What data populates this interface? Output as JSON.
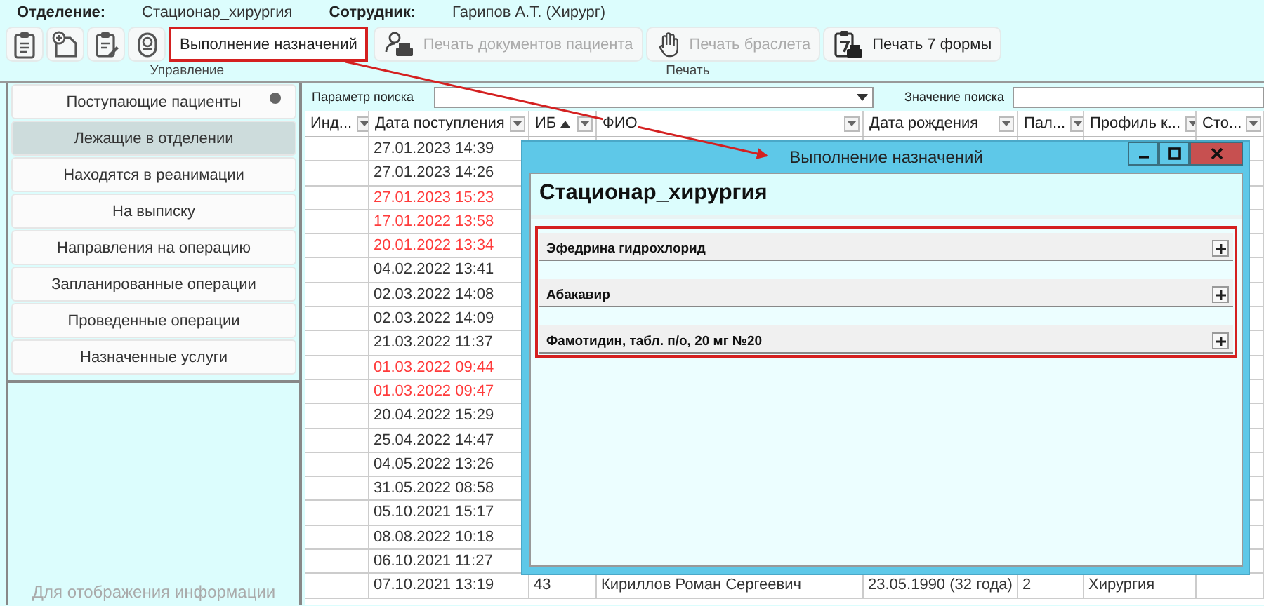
{
  "header": {
    "department_label": "Отделение:",
    "department": "Стационар_хирургия",
    "employee_label": "Сотрудник:",
    "employee": "Гарипов А.Т. (Хирург)"
  },
  "toolbar": [
    {
      "label": "Управление",
      "buttons": [
        {
          "kind": "icon"
        },
        {
          "kind": "icon"
        },
        {
          "kind": "icon"
        },
        {
          "kind": "icon"
        },
        {
          "kind": "text",
          "label": "Выполнение назначений",
          "disabled": false,
          "highlighted": true
        }
      ]
    },
    {
      "label": "Печать",
      "buttons": [
        {
          "kind": "text",
          "label": "Печать документов пациента",
          "disabled": true,
          "highlighted": false
        },
        {
          "kind": "text",
          "label": "Печать браслета",
          "disabled": true,
          "highlighted": false
        },
        {
          "kind": "text",
          "label": "Печать 7 формы",
          "disabled": false,
          "highlighted": false
        }
      ]
    }
  ],
  "callout_arrow": true,
  "sidebar": {
    "items": [
      {
        "label": "Поступающие пациенты",
        "selected": false,
        "indicator": true
      },
      {
        "label": "Лежащие в отделении",
        "selected": true,
        "indicator": false
      },
      {
        "label": "Находятся в реанимации",
        "selected": false,
        "indicator": false
      },
      {
        "label": "На выписку",
        "selected": false,
        "indicator": false
      },
      {
        "label": "Направления на операцию",
        "selected": false,
        "indicator": false
      },
      {
        "label": "Запланированные операции",
        "selected": false,
        "indicator": false
      },
      {
        "label": "Проведенные операции",
        "selected": false,
        "indicator": false
      },
      {
        "label": "Назначенные услуги",
        "selected": false,
        "indicator": false
      }
    ],
    "info_text": "Для отображения информации"
  },
  "search": {
    "param_label": "Параметр поиска",
    "value_label": "Значение поиска"
  },
  "table": {
    "columns": [
      {
        "label": "Инд...",
        "sorted": false
      },
      {
        "label": "Дата поступления",
        "sorted": false
      },
      {
        "label": "ИБ",
        "sorted": true
      },
      {
        "label": "ФИО",
        "sorted": false
      },
      {
        "label": "Дата рождения",
        "sorted": false
      },
      {
        "label": "Пал...",
        "sorted": false
      },
      {
        "label": "Профиль к...",
        "sorted": false
      },
      {
        "label": "Сто...",
        "sorted": false
      }
    ],
    "rows": [
      {
        "cells": [
          "",
          "27.01.2023 14:39"
        ],
        "color": "#333333"
      },
      {
        "cells": [
          "",
          "27.01.2023 14:26"
        ],
        "color": "#333333"
      },
      {
        "cells": [
          "",
          "27.01.2023 15:23"
        ],
        "color": "#ff3b3b"
      },
      {
        "cells": [
          "",
          "17.01.2022 13:58"
        ],
        "color": "#ff3b3b"
      },
      {
        "cells": [
          "",
          "20.01.2022 13:34"
        ],
        "color": "#ff3b3b"
      },
      {
        "cells": [
          "",
          "04.02.2022 13:41"
        ],
        "color": "#333333"
      },
      {
        "cells": [
          "",
          "02.03.2022 14:08"
        ],
        "color": "#333333"
      },
      {
        "cells": [
          "",
          "02.03.2022 14:09"
        ],
        "color": "#333333"
      },
      {
        "cells": [
          "",
          "21.03.2022 11:37"
        ],
        "color": "#333333"
      },
      {
        "cells": [
          "",
          "01.03.2022 09:44"
        ],
        "color": "#ff3b3b"
      },
      {
        "cells": [
          "",
          "01.03.2022 09:47"
        ],
        "color": "#ff3b3b"
      },
      {
        "cells": [
          "",
          "20.04.2022 15:29"
        ],
        "color": "#333333"
      },
      {
        "cells": [
          "",
          "25.04.2022 14:47"
        ],
        "color": "#333333"
      },
      {
        "cells": [
          "",
          "04.05.2022 13:26"
        ],
        "color": "#333333"
      },
      {
        "cells": [
          "",
          "31.05.2022 08:58"
        ],
        "color": "#333333"
      },
      {
        "cells": [
          "",
          "05.10.2021 15:17"
        ],
        "color": "#333333"
      },
      {
        "cells": [
          "",
          "08.08.2022 10:18"
        ],
        "color": "#333333"
      },
      {
        "cells": [
          "",
          "06.10.2021 11:27"
        ],
        "color": "#333333"
      },
      {
        "cells": [
          "",
          "07.10.2021 13:19",
          "43",
          "Кириллов Роман Сергеевич",
          "23.05.1990 (32 года)",
          "2",
          "Хирургия",
          ""
        ],
        "color": "#333333"
      }
    ]
  },
  "dialog": {
    "title": "Выполнение назначений",
    "heading": "Стационар_хирургия",
    "highlighted": true,
    "items": [
      {
        "label": "Эфедрина гидрохлорид",
        "expanded": false
      },
      {
        "label": "Абакавир",
        "expanded": false
      },
      {
        "label": "Фамотидин, табл. п/о, 20 мг №20",
        "expanded": false
      }
    ]
  }
}
